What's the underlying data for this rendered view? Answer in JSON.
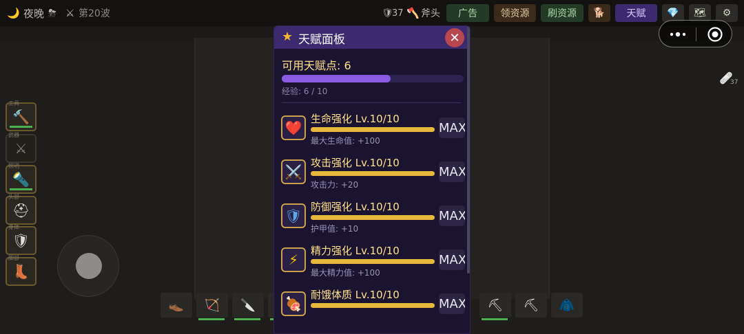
{
  "topbar": {
    "time_of_day": "夜晚",
    "wave": "第20波",
    "defense": "37",
    "tool": "斧头",
    "buttons": {
      "ad": "广告",
      "claim_resources": "领资源",
      "refresh_resources": "刷资源",
      "talent": "天赋"
    }
  },
  "panel": {
    "title": "天赋面板",
    "points_label": "可用天赋点: 6",
    "xp_label": "经验: 6 / 10",
    "xp_fraction": 0.6,
    "close_symbol": "✕",
    "talents": [
      {
        "name": "生命强化 Lv.10/10",
        "desc": "最大生命值: +100",
        "icon": "heart-icon",
        "glyph": "❤️",
        "fill": 1.0,
        "max_label": "MAX"
      },
      {
        "name": "攻击强化 Lv.10/10",
        "desc": "攻击力: +20",
        "icon": "crossed-swords-icon",
        "glyph": "⚔️",
        "fill": 1.0,
        "max_label": "MAX"
      },
      {
        "name": "防御强化 Lv.10/10",
        "desc": "护甲值: +10",
        "icon": "shield-icon",
        "glyph": "🛡",
        "fill": 1.0,
        "max_label": "MAX"
      },
      {
        "name": "精力强化 Lv.10/10",
        "desc": "最大精力值: +100",
        "icon": "lightning-icon",
        "glyph": "⚡",
        "fill": 1.0,
        "max_label": "MAX"
      },
      {
        "name": "耐饿体质 Lv.10/10",
        "desc": "",
        "icon": "meat-icon",
        "glyph": "🍖",
        "fill": 1.0,
        "max_label": "MAX"
      }
    ]
  },
  "equipment_slots": [
    {
      "label": "工具",
      "icon": "hammer-icon",
      "glyph": "🔨"
    },
    {
      "label": "武器",
      "icon": "sword-icon",
      "glyph": "⚔"
    },
    {
      "label": "照明",
      "icon": "flashlight-icon",
      "glyph": "🔦"
    },
    {
      "label": "头部",
      "icon": "helmet-icon",
      "glyph": "⛑"
    },
    {
      "label": "身体",
      "icon": "armor-icon",
      "glyph": "🛡"
    },
    {
      "label": "脚部",
      "icon": "boot-icon",
      "glyph": "👢"
    }
  ],
  "hotbar": [
    {
      "icon": "boot-icon",
      "glyph": "👞"
    },
    {
      "icon": "bow-icon",
      "glyph": "🏹"
    },
    {
      "icon": "knife-icon",
      "glyph": "🔪"
    },
    {
      "icon": "pickaxe-icon",
      "glyph": "⛏"
    },
    {
      "icon": "pickaxe-icon",
      "glyph": "⛏"
    },
    {
      "icon": "jacket-icon",
      "glyph": "🧥"
    }
  ],
  "right_tool_count": "37",
  "colors": {
    "panel_bg": "#1a1431",
    "panel_header": "#3b2a6e",
    "accent_gold": "#ffe28a",
    "xp_purple": "#8a5ae0",
    "bar_gold": "#e7b83c"
  }
}
